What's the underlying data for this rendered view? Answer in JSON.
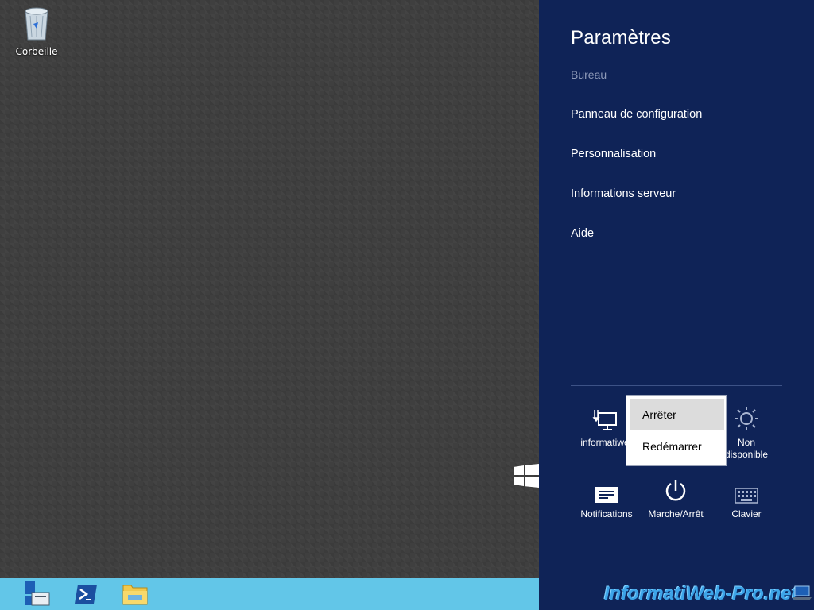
{
  "desktop": {
    "recycle_bin_label": "Corbeille"
  },
  "taskbar": {
    "items": [
      {
        "icon": "server-manager-icon"
      },
      {
        "icon": "powershell-icon"
      },
      {
        "icon": "file-explorer-icon"
      }
    ]
  },
  "charms": {
    "title": "Paramètres",
    "subtitle": "Bureau",
    "links": [
      "Panneau de configuration",
      "Personnalisation",
      "Informations serveur",
      "Aide"
    ],
    "tiles": {
      "network": {
        "label": "informatiwe",
        "icon": "network-icon"
      },
      "brightness": {
        "label_line1": "Non",
        "label_line2": "disponible",
        "icon": "brightness-icon"
      },
      "notifications": {
        "label": "Notifications",
        "icon": "notifications-icon"
      },
      "power": {
        "label": "Marche/Arrêt",
        "icon": "power-icon"
      },
      "keyboard": {
        "label": "Clavier",
        "icon": "keyboard-icon"
      }
    }
  },
  "power_menu": {
    "items": [
      "Arrêter",
      "Redémarrer"
    ],
    "highlighted": "Arrêter"
  },
  "watermark": {
    "text": "InformatiWeb-Pro.net"
  },
  "colors": {
    "charms_bg": "#0f2357",
    "taskbar_bg": "#62c6e8",
    "desktop_bg": "#3f3f3f"
  }
}
